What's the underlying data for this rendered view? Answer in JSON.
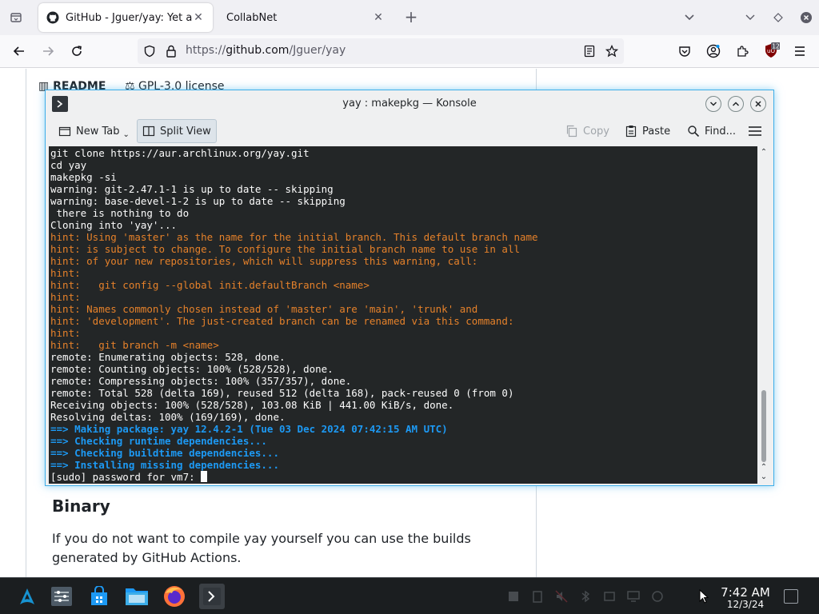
{
  "browser": {
    "tabs": [
      {
        "title": "GitHub - Jguer/yay: Yet an",
        "active": true,
        "icon": "github-icon"
      },
      {
        "title": "CollabNet",
        "active": false,
        "icon": ""
      }
    ],
    "url": {
      "protocol": "https://",
      "host": "github.com",
      "path": "/Jguer/yay"
    },
    "extension_badge": "12"
  },
  "page": {
    "tabs": [
      "README",
      "GPL-3.0 license"
    ],
    "binary_heading": "Binary",
    "binary_text": "If you do not want to compile yay yourself you can use the builds generated by GitHub Actions."
  },
  "konsole": {
    "title": "yay : makepkg — Konsole",
    "toolbar": {
      "new_tab": "New Tab",
      "split_view": "Split View",
      "copy": "Copy",
      "paste": "Paste",
      "find": "Find..."
    },
    "lines": [
      {
        "t": "git clone https://aur.archlinux.org/yay.git",
        "c": ""
      },
      {
        "t": "cd yay",
        "c": ""
      },
      {
        "t": "makepkg -si",
        "c": ""
      },
      {
        "t": "warning: git-2.47.1-1 is up to date -- skipping",
        "c": ""
      },
      {
        "t": "warning: base-devel-1-2 is up to date -- skipping",
        "c": ""
      },
      {
        "t": " there is nothing to do",
        "c": ""
      },
      {
        "t": "Cloning into 'yay'...",
        "c": ""
      },
      {
        "t": "hint: Using 'master' as the name for the initial branch. This default branch name",
        "c": "hint"
      },
      {
        "t": "hint: is subject to change. To configure the initial branch name to use in all",
        "c": "hint"
      },
      {
        "t": "hint: of your new repositories, which will suppress this warning, call:",
        "c": "hint"
      },
      {
        "t": "hint:",
        "c": "hint"
      },
      {
        "t": "hint:   git config --global init.defaultBranch <name>",
        "c": "hint"
      },
      {
        "t": "hint:",
        "c": "hint"
      },
      {
        "t": "hint: Names commonly chosen instead of 'master' are 'main', 'trunk' and",
        "c": "hint"
      },
      {
        "t": "hint: 'development'. The just-created branch can be renamed via this command:",
        "c": "hint"
      },
      {
        "t": "hint:",
        "c": "hint"
      },
      {
        "t": "hint:   git branch -m <name>",
        "c": "hint"
      },
      {
        "t": "remote: Enumerating objects: 528, done.",
        "c": ""
      },
      {
        "t": "remote: Counting objects: 100% (528/528), done.",
        "c": ""
      },
      {
        "t": "remote: Compressing objects: 100% (357/357), done.",
        "c": ""
      },
      {
        "t": "remote: Total 528 (delta 169), reused 512 (delta 168), pack-reused 0 (from 0)",
        "c": ""
      },
      {
        "t": "Receiving objects: 100% (528/528), 103.08 KiB | 441.00 KiB/s, done.",
        "c": ""
      },
      {
        "t": "Resolving deltas: 100% (169/169), done.",
        "c": ""
      },
      {
        "t": "==> Making package: yay 12.4.2-1 (Tue 03 Dec 2024 07:42:15 AM UTC)",
        "c": "blue"
      },
      {
        "t": "==> Checking runtime dependencies...",
        "c": "blue"
      },
      {
        "t": "==> Checking buildtime dependencies...",
        "c": "blue"
      },
      {
        "t": "==> Installing missing dependencies...",
        "c": "blue"
      }
    ],
    "prompt": "[sudo] password for vm7: "
  },
  "taskbar": {
    "time": "7:42 AM",
    "date": "12/3/24"
  },
  "colors": {
    "hint": "#e5812a",
    "blue": "#1d99f3",
    "terminal_bg": "#232627",
    "accent": "#3daee9"
  }
}
